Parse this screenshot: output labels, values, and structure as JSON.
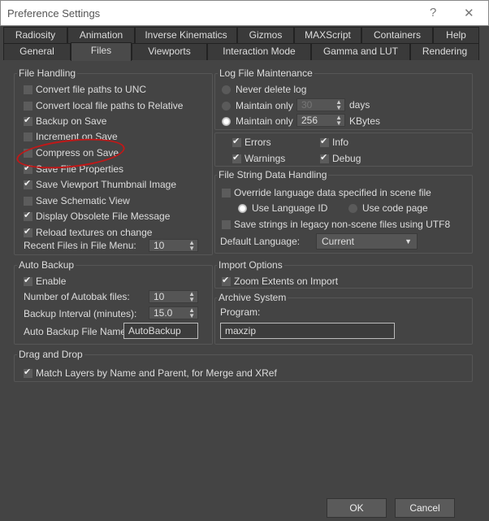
{
  "window": {
    "title": "Preference Settings",
    "help": "?",
    "close": "✕"
  },
  "tabs_row1": [
    "Radiosity",
    "Animation",
    "Inverse Kinematics",
    "Gizmos",
    "MAXScript",
    "Containers",
    "Help"
  ],
  "tabs_row2": [
    "General",
    "Files",
    "Viewports",
    "Interaction Mode",
    "Gamma and LUT",
    "Rendering"
  ],
  "file_handling": {
    "label": "File Handling",
    "items": [
      {
        "label": "Convert file paths to UNC",
        "checked": false
      },
      {
        "label": "Convert local file paths to Relative",
        "checked": false
      },
      {
        "label": "Backup on Save",
        "checked": true
      },
      {
        "label": "Increment on Save",
        "checked": false
      },
      {
        "label": "Compress on Save",
        "checked": false
      },
      {
        "label": "Save File Properties",
        "checked": true
      },
      {
        "label": "Save Viewport Thumbnail Image",
        "checked": true
      },
      {
        "label": "Save Schematic View",
        "checked": false
      },
      {
        "label": "Display Obsolete File Message",
        "checked": true
      },
      {
        "label": "Reload textures on change",
        "checked": true
      }
    ],
    "recent_label": "Recent Files in File Menu:",
    "recent_value": "10"
  },
  "auto_backup": {
    "label": "Auto Backup",
    "enable": "Enable",
    "num_label": "Number of Autobak files:",
    "num_value": "10",
    "interval_label": "Backup Interval (minutes):",
    "interval_value": "15.0",
    "name_label": "Auto Backup File Name:",
    "name_value": "AutoBackup"
  },
  "log": {
    "label": "Log File Maintenance",
    "never": "Never delete log",
    "maintain1": "Maintain only",
    "days_value": "30",
    "days": "days",
    "maintain2": "Maintain only",
    "kb_value": "256",
    "kb": "KBytes",
    "errors": "Errors",
    "info": "Info",
    "warnings": "Warnings",
    "debug": "Debug"
  },
  "file_string": {
    "label": "File String Data Handling",
    "override": "Override language data specified in scene file",
    "use_lang": "Use Language ID",
    "use_code": "Use code page",
    "utf8": "Save strings in legacy non-scene files using UTF8",
    "default_lang_label": "Default Language:",
    "default_lang_value": "Current"
  },
  "import": {
    "label": "Import Options",
    "zoom": "Zoom Extents on Import"
  },
  "archive": {
    "label": "Archive System",
    "program_label": "Program:",
    "program_value": "maxzip"
  },
  "drag": {
    "label": "Drag and Drop",
    "match": "Match Layers by Name and Parent, for Merge and XRef"
  },
  "buttons": {
    "ok": "OK",
    "cancel": "Cancel"
  },
  "annotation_color": "#c01818"
}
